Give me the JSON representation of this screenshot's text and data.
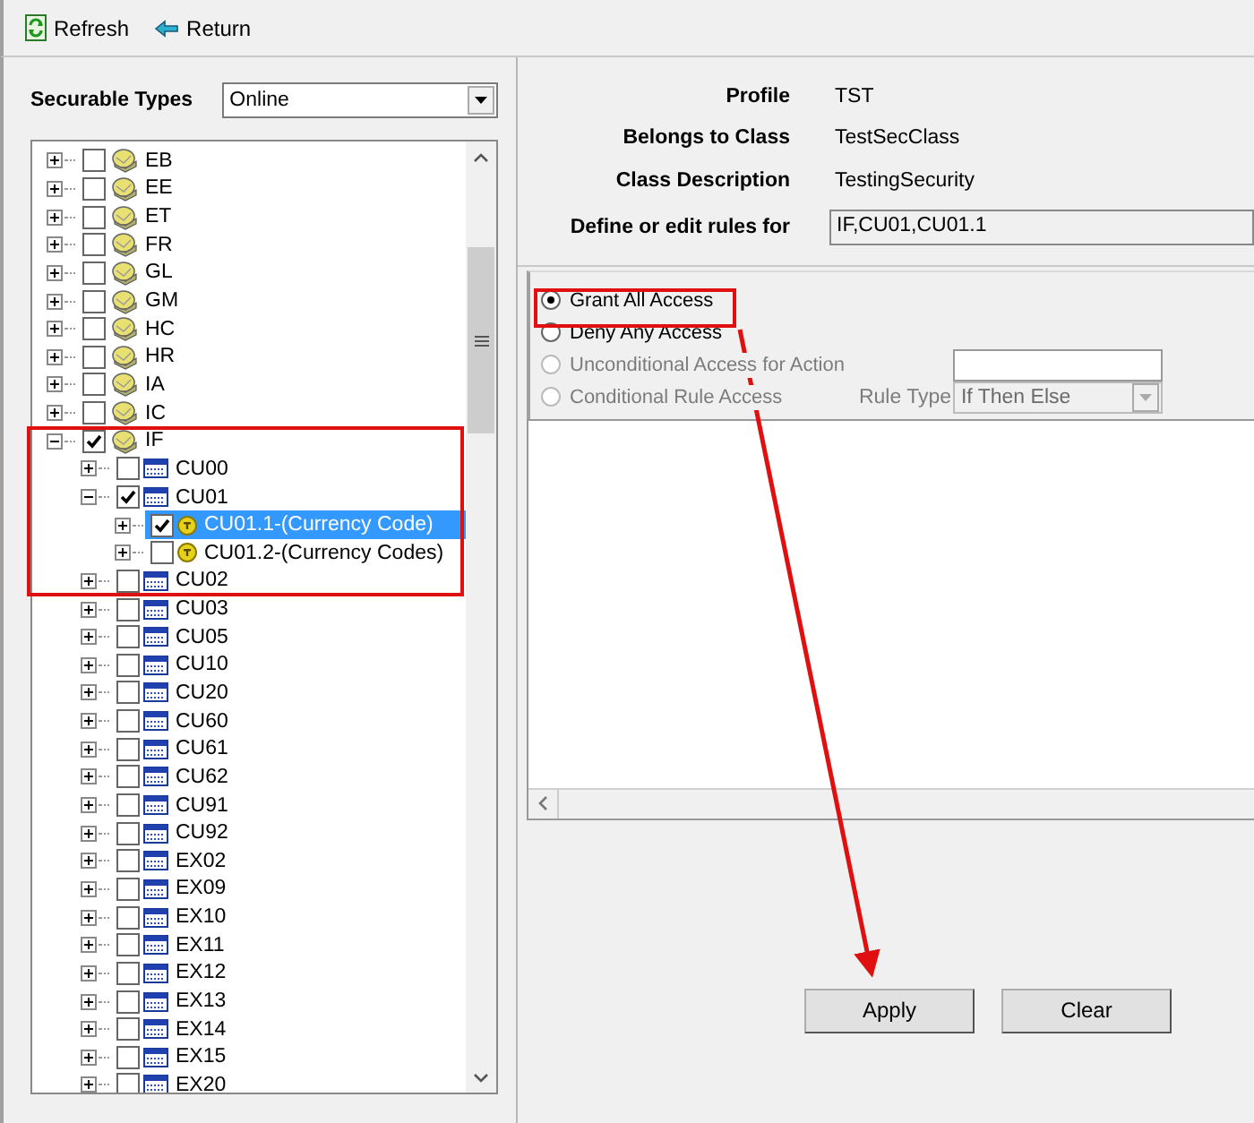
{
  "toolbar": [
    {
      "label": "Refresh",
      "kind": "refresh"
    },
    {
      "label": "Return",
      "kind": "return"
    }
  ],
  "securable_types": {
    "label": "Securable Types",
    "value": "Online"
  },
  "tree": {
    "items": [
      {
        "label": "EB",
        "kind": "module",
        "checked": false,
        "expanded": false,
        "selected": false
      },
      {
        "label": "EE",
        "kind": "module",
        "checked": false,
        "expanded": false,
        "selected": false
      },
      {
        "label": "ET",
        "kind": "module",
        "checked": false,
        "expanded": false,
        "selected": false
      },
      {
        "label": "FR",
        "kind": "module",
        "checked": false,
        "expanded": false,
        "selected": false
      },
      {
        "label": "GL",
        "kind": "module",
        "checked": false,
        "expanded": false,
        "selected": false
      },
      {
        "label": "GM",
        "kind": "module",
        "checked": false,
        "expanded": false,
        "selected": false
      },
      {
        "label": "HC",
        "kind": "module",
        "checked": false,
        "expanded": false,
        "selected": false
      },
      {
        "label": "HR",
        "kind": "module",
        "checked": false,
        "expanded": false,
        "selected": false
      },
      {
        "label": "IA",
        "kind": "module",
        "checked": false,
        "expanded": false,
        "selected": false
      },
      {
        "label": "IC",
        "kind": "module",
        "checked": false,
        "expanded": false,
        "selected": false
      },
      {
        "label": "IF",
        "kind": "module",
        "checked": true,
        "expanded": true,
        "selected": false,
        "children": [
          {
            "label": "CU00",
            "kind": "table",
            "checked": false,
            "expanded": false,
            "selected": false
          },
          {
            "label": "CU01",
            "kind": "table",
            "checked": true,
            "expanded": true,
            "selected": false,
            "children": [
              {
                "label": "CU01.1-(Currency Code)",
                "kind": "field",
                "checked": true,
                "expanded": false,
                "selected": true
              },
              {
                "label": "CU01.2-(Currency Codes)",
                "kind": "field",
                "checked": false,
                "expanded": false,
                "selected": false
              }
            ]
          },
          {
            "label": "CU02",
            "kind": "table",
            "checked": false,
            "expanded": false,
            "selected": false
          },
          {
            "label": "CU03",
            "kind": "table",
            "checked": false,
            "expanded": false,
            "selected": false
          },
          {
            "label": "CU05",
            "kind": "table",
            "checked": false,
            "expanded": false,
            "selected": false
          },
          {
            "label": "CU10",
            "kind": "table",
            "checked": false,
            "expanded": false,
            "selected": false
          },
          {
            "label": "CU20",
            "kind": "table",
            "checked": false,
            "expanded": false,
            "selected": false
          },
          {
            "label": "CU60",
            "kind": "table",
            "checked": false,
            "expanded": false,
            "selected": false
          },
          {
            "label": "CU61",
            "kind": "table",
            "checked": false,
            "expanded": false,
            "selected": false
          },
          {
            "label": "CU62",
            "kind": "table",
            "checked": false,
            "expanded": false,
            "selected": false
          },
          {
            "label": "CU91",
            "kind": "table",
            "checked": false,
            "expanded": false,
            "selected": false
          },
          {
            "label": "CU92",
            "kind": "table",
            "checked": false,
            "expanded": false,
            "selected": false
          },
          {
            "label": "EX02",
            "kind": "table",
            "checked": false,
            "expanded": false,
            "selected": false
          },
          {
            "label": "EX09",
            "kind": "table",
            "checked": false,
            "expanded": false,
            "selected": false
          },
          {
            "label": "EX10",
            "kind": "table",
            "checked": false,
            "expanded": false,
            "selected": false
          },
          {
            "label": "EX11",
            "kind": "table",
            "checked": false,
            "expanded": false,
            "selected": false
          },
          {
            "label": "EX12",
            "kind": "table",
            "checked": false,
            "expanded": false,
            "selected": false
          },
          {
            "label": "EX13",
            "kind": "table",
            "checked": false,
            "expanded": false,
            "selected": false
          },
          {
            "label": "EX14",
            "kind": "table",
            "checked": false,
            "expanded": false,
            "selected": false
          },
          {
            "label": "EX15",
            "kind": "table",
            "checked": false,
            "expanded": false,
            "selected": false
          },
          {
            "label": "EX20",
            "kind": "table",
            "checked": false,
            "expanded": false,
            "selected": false
          }
        ]
      }
    ]
  },
  "details": [
    {
      "label": "Profile",
      "value": "TST"
    },
    {
      "label": "Belongs to Class",
      "value": "TestSecClass"
    },
    {
      "label": "Class Description",
      "value": "TestingSecurity"
    }
  ],
  "rules_for": {
    "label": "Define or edit rules for",
    "value": "IF,CU01,CU01.1"
  },
  "access_options": [
    {
      "label": "Grant All Access",
      "selected": true,
      "disabled": false
    },
    {
      "label": "Deny Any Access",
      "selected": false,
      "disabled": false
    },
    {
      "label": "Unconditional Access for Action",
      "selected": false,
      "disabled": true
    },
    {
      "label": "Conditional Rule Access",
      "selected": false,
      "disabled": true
    }
  ],
  "rule_type": {
    "label": "Rule Type",
    "value": "If Then Else",
    "disabled": true
  },
  "buttons": [
    {
      "label": "Apply"
    },
    {
      "label": "Clear"
    }
  ]
}
